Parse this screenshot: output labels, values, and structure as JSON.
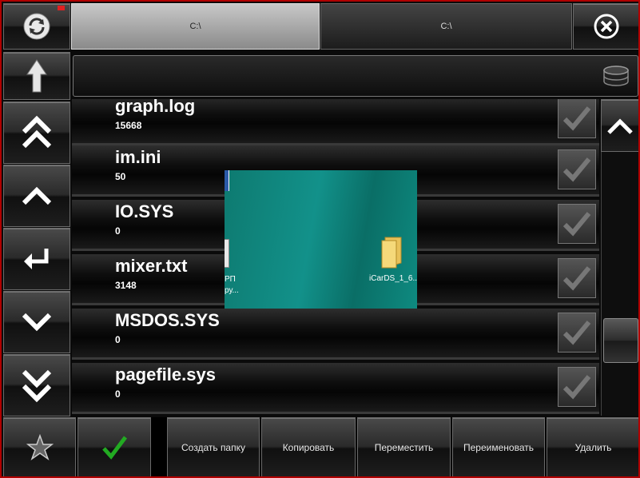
{
  "tabs": [
    {
      "label": "C:\\"
    },
    {
      "label": "C:\\"
    }
  ],
  "path": {
    "value": ""
  },
  "files": [
    {
      "name": "graph.log",
      "size": "15668"
    },
    {
      "name": "im.ini",
      "size": "50"
    },
    {
      "name": "IO.SYS",
      "size": "0"
    },
    {
      "name": "mixer.txt",
      "size": "3148"
    },
    {
      "name": "MSDOS.SYS",
      "size": "0"
    },
    {
      "name": "pagefile.sys",
      "size": "0"
    }
  ],
  "overlay": {
    "folder_label": "iCarDS_1_6...",
    "doc_label_line1": "РП",
    "doc_label_line2": "ру..."
  },
  "toolbar": {
    "create_folder": "Создать папку",
    "copy": "Копировать",
    "move": "Переместить",
    "rename": "Переименовать",
    "delete": "Удалить"
  },
  "icons": {
    "refresh": "refresh-icon",
    "up_dir": "arrow-up-icon",
    "page_up": "double-chevron-up-icon",
    "line_up": "chevron-up-icon",
    "enter": "enter-icon",
    "line_down": "chevron-down-icon",
    "page_down": "double-chevron-down-icon",
    "close": "close-icon",
    "database": "database-icon",
    "favorites": "star-icon",
    "select": "checkmark-icon"
  },
  "colors": {
    "frame": "#b00000",
    "check_accent": "#22aa22",
    "overlay_teal": "#12918a"
  }
}
